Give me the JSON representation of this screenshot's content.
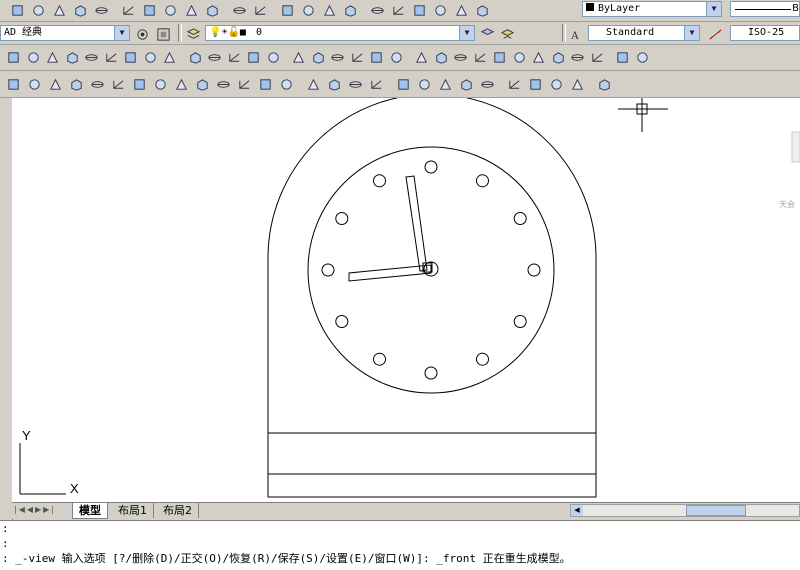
{
  "toolbar_row2": {
    "workspace_value": "AD 经典",
    "layer_value": "0"
  },
  "properties": {
    "color_value": "ByLayer",
    "linetype_value": "B"
  },
  "styles": {
    "text_style_value": "Standard",
    "dim_style_value": "ISO-25"
  },
  "layout_tabs": [
    "模型",
    "布局1",
    "布局2"
  ],
  "command_lines": [
    ":",
    ":",
    ": _-view 输入选项 [?/删除(D)/正交(O)/恢复(R)/保存(S)/设置(E)/窗口(W)]: _front 正在重生成模型。"
  ],
  "ucs": {
    "x_label": "X",
    "y_label": "Y"
  },
  "side_hint": "天会",
  "icons": {
    "row1": [
      "save-icon",
      "print-icon",
      "print-preview-icon",
      "plot-icon",
      "publish-icon",
      "cut-icon",
      "copy-icon",
      "paste-icon",
      "match-properties-icon",
      "block-editor-icon",
      "undo-icon",
      "redo-icon",
      "pan-icon",
      "zoom-realtime-icon",
      "zoom-window-icon",
      "zoom-previous-icon",
      "properties-icon",
      "design-center-icon",
      "tool-palettes-icon",
      "sheet-set-icon",
      "markup-icon",
      "quickcalc-icon"
    ],
    "row3": [
      "box-icon",
      "wedge-icon",
      "cone-icon",
      "sphere-icon",
      "cylinder-icon",
      "torus-icon",
      "pyramid-icon",
      "helix-icon",
      "planar-surface-icon",
      "extrude-icon",
      "presspull-icon",
      "sweep-icon",
      "revolve-icon",
      "loft-icon",
      "union-icon",
      "subtract-icon",
      "intersect-icon",
      "3d-move-icon",
      "3d-rotate-icon",
      "3d-align-icon",
      "view-top-icon",
      "view-bottom-icon",
      "view-left-icon",
      "view-right-icon",
      "view-front-icon",
      "view-back-icon",
      "view-sw-icon",
      "view-se-icon",
      "view-ne-icon",
      "view-nw-icon",
      "camera-icon",
      "zoom-extents-icon"
    ],
    "row4": [
      "edit-face-icon",
      "extrude-face-icon",
      "move-face-icon",
      "offset-face-icon",
      "delete-face-icon",
      "rotate-face-icon",
      "taper-face-icon",
      "copy-face-icon",
      "color-face-icon",
      "imprint-icon",
      "clean-icon",
      "separate-icon",
      "shell-icon",
      "check-icon",
      "linear-dim-icon",
      "aligned-dim-icon",
      "arc-length-icon",
      "ordinate-icon",
      "radius-icon",
      "jogged-icon",
      "diameter-icon",
      "angular-icon",
      "quick-dim-icon",
      "baseline-icon",
      "continue-icon",
      "qleader-icon",
      "tolerance-icon",
      "center-mark-icon"
    ]
  },
  "colors": {
    "toolbar": "#d4d0c8",
    "canvas": "#ffffff",
    "accent": "#316ac5"
  }
}
